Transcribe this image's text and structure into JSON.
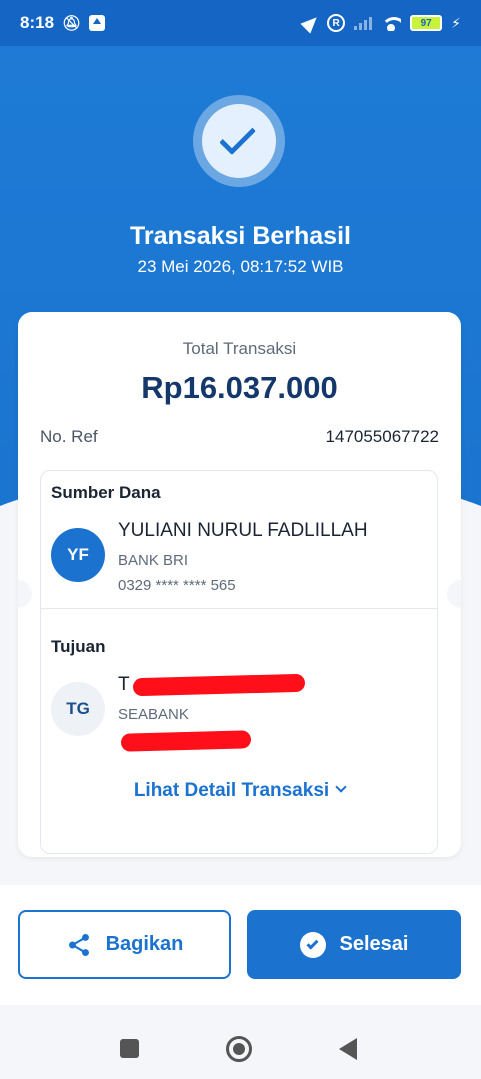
{
  "status_bar": {
    "time": "8:18",
    "battery": "97",
    "icons": [
      "mute-icon",
      "upload-icon",
      "location-icon",
      "r-icon",
      "signal-icon",
      "wifi-icon",
      "battery-icon",
      "charging-icon"
    ]
  },
  "header": {
    "title": "Transaksi Berhasil",
    "datetime": "23 Mei 2026, 08:17:52 WIB"
  },
  "transaction": {
    "total_label": "Total Transaksi",
    "total_amount": "Rp16.037.000",
    "ref_label": "No. Ref",
    "ref_value": "147055067722"
  },
  "source": {
    "label": "Sumber Dana",
    "initials": "YF",
    "name": "YULIANI NURUL FADLILLAH",
    "bank": "BANK BRI",
    "account": "0329 **** **** 565"
  },
  "destination": {
    "label": "Tujuan",
    "initials": "TG",
    "name_visible": "T",
    "bank": "SEABANK"
  },
  "detail_link": "Lihat Detail Transaksi",
  "buttons": {
    "share": "Bagikan",
    "done": "Selesai"
  },
  "colors": {
    "primary": "#1b73cf",
    "header_bg": "#1e7bd6",
    "amount": "#14386b",
    "redaction": "#ff0f1a"
  }
}
